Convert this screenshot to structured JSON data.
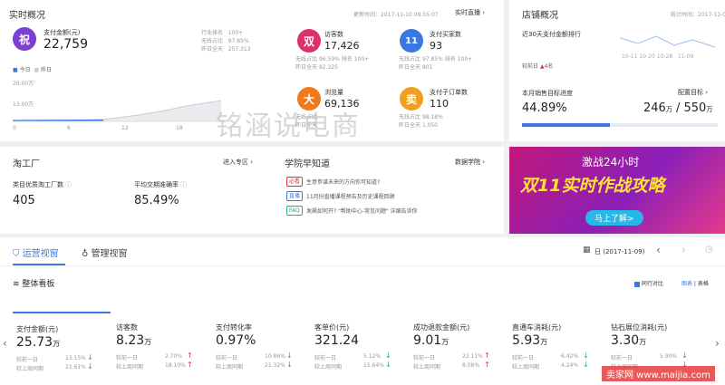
{
  "realtime": {
    "title": "实时概况",
    "update_time": "更新时间：2017-11-10 09:55:07",
    "live_link": "实时直播",
    "main": {
      "icon_char": "祝",
      "label": "支付金额(元)",
      "value": "22,759",
      "rank_label": "行业排名",
      "rank_value": "100+",
      "wireless_label": "无线占比",
      "wireless_value": "97.85%",
      "yesterday_label": "昨日全天",
      "yesterday_value": "257,313"
    },
    "legend_today": "今日",
    "legend_yesterday": "昨日",
    "y_top": "26.00万",
    "y_mid": "13.00万",
    "x_ticks": [
      "0",
      "6",
      "12",
      "18"
    ],
    "cards": [
      {
        "icon_char": "双",
        "color": "#e0306a",
        "label": "访客数",
        "value": "17,426",
        "l1": "无线占比",
        "v1": "96.59%",
        "r1l": "排名",
        "r1v": "100+",
        "l2": "昨日全天",
        "v2": "82,325"
      },
      {
        "icon_char": "11",
        "color": "#3a78e0",
        "label": "支付买家数",
        "value": "93",
        "l1": "无线占比",
        "v1": "97.85%",
        "r1l": "排名",
        "r1v": "100+",
        "l2": "昨日全天",
        "v2": "801"
      },
      {
        "icon_char": "大",
        "color": "#f07a1a",
        "label": "浏览量",
        "value": "69,136",
        "l1": "无线占比",
        "v1": "",
        "r1l": "",
        "r1v": "",
        "l2": "昨日全天",
        "v2": ""
      },
      {
        "icon_char": "卖",
        "color": "#f0a020",
        "label": "支付子订单数",
        "value": "110",
        "l1": "无线占比",
        "v1": "98.18%",
        "r1l": "",
        "r1v": "",
        "l2": "昨日全天",
        "v2": "1,050"
      }
    ]
  },
  "chart_data": {
    "type": "area",
    "title": "",
    "xlabel": "",
    "ylabel": "",
    "x_ticks": [
      "0",
      "6",
      "12",
      "18"
    ],
    "ylim": [
      0,
      26
    ],
    "series": [
      {
        "name": "今日",
        "values": [
          [
            0,
            0.5
          ],
          [
            10,
            0.8
          ]
        ]
      },
      {
        "name": "昨日",
        "values": [
          [
            0,
            0.5
          ],
          [
            6,
            0.6
          ],
          [
            10,
            1.2
          ],
          [
            14,
            4
          ],
          [
            17,
            7
          ],
          [
            19,
            9.5
          ],
          [
            23,
            13
          ]
        ]
      }
    ]
  },
  "store": {
    "title": "店铺概况",
    "stat_time": "统计时间：2017-11-09",
    "rank_title": "近30天支付金额排行",
    "prev_label": "较前日",
    "prev_value": "4名",
    "x_dates": [
      "10-11",
      "10-20",
      "10-28",
      "11-09"
    ],
    "target_label": "本月销售目标进度",
    "target_link": "配置目标",
    "percent": "44.89%",
    "progress": 0.4489,
    "cur": "246",
    "cur_unit": "万",
    "total": "550",
    "total_unit": "万"
  },
  "watermark": "铭涵说电商",
  "taogongchang": {
    "title": "淘工厂",
    "link": "进入专区",
    "m1_label": "类目优质淘工厂数",
    "m1_value": "405",
    "m2_label": "平均交期准确率",
    "m2_value": "85.49%"
  },
  "academy": {
    "title": "学院早知道",
    "link": "数据学院",
    "items": [
      {
        "tag": "必看",
        "tag_color": "#e5322d",
        "text": "生意参谋未来的方向你可知道?"
      },
      {
        "tag": "直播",
        "tag_color": "#3a78e0",
        "text": "11月份直播课程预告及历史课程回顾"
      },
      {
        "tag": "FAQ",
        "tag_color": "#19b56f",
        "text": "发飙如何开? \"帮助中心-常见问题\" 详细告诉你"
      }
    ]
  },
  "banner": {
    "top": "激战24小时",
    "main": "双11实时作战攻略",
    "button": "马上了解>"
  },
  "tabs": {
    "t1": "运营视窗",
    "t2": "管理视窗",
    "date": "日 (2017-11-09)"
  },
  "board": {
    "title": "整体看板",
    "compare": "同行对比",
    "view_chart": "图表",
    "view_table": "表格",
    "metrics": [
      {
        "name": "支付金额(元)",
        "value": "25.73",
        "unit": "万",
        "d1": "13.15%",
        "a1": "dn",
        "d2": "21.61%",
        "a2": "dn"
      },
      {
        "name": "访客数",
        "value": "8.23",
        "unit": "万",
        "d1": "2.70%",
        "a1": "up",
        "d2": "18.10%",
        "a2": "up"
      },
      {
        "name": "支付转化率",
        "value": "0.97%",
        "unit": "",
        "d1": "10.86%",
        "a1": "dn",
        "d2": "21.32%",
        "a2": "dn"
      },
      {
        "name": "客单价(元)",
        "value": "321.24",
        "unit": "",
        "d1": "5.12%",
        "a1": "dn",
        "d2": "15.64%",
        "a2": "dn"
      },
      {
        "name": "成功退款金额(元)",
        "value": "9.01",
        "unit": "万",
        "d1": "22.11%",
        "a1": "up",
        "d2": "8.08%",
        "a2": "up"
      },
      {
        "name": "直通车消耗(元)",
        "value": "5.93",
        "unit": "万",
        "d1": "6.42%",
        "a1": "dn",
        "d2": "4.24%",
        "a2": "dn"
      },
      {
        "name": "钻石展位消耗(元)",
        "value": "3.30",
        "unit": "万",
        "d1": "5.90%",
        "a1": "dn",
        "d2": "",
        "a2": "dn"
      }
    ],
    "r1": "较前一日",
    "r2": "较上周同期"
  },
  "site_wm": "卖家网 www.maijia.com"
}
